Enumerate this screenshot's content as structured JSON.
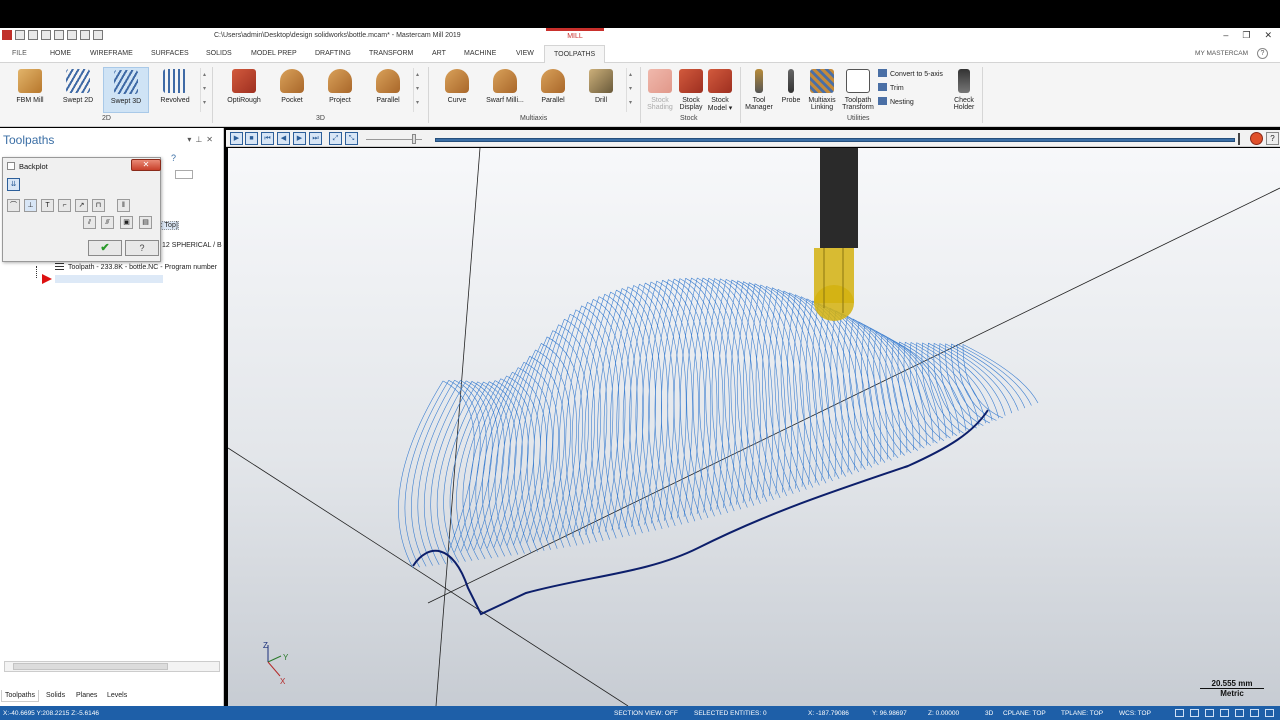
{
  "window": {
    "title": "C:\\Users\\admin\\Desktop\\design solidworks\\bottle.mcam* - Mastercam Mill 2019",
    "context_tab": "MILL",
    "controls": [
      "–",
      "❐",
      "✕"
    ]
  },
  "ribbon_tabs": [
    "FILE",
    "HOME",
    "WIREFRAME",
    "SURFACES",
    "SOLIDS",
    "MODEL PREP",
    "DRAFTING",
    "TRANSFORM",
    "ART",
    "MACHINE",
    "VIEW",
    "TOOLPATHS"
  ],
  "ribbon_active_tab": "TOOLPATHS",
  "my_mastercam": "MY MASTERCAM",
  "ribbon": {
    "group_2d": {
      "label": "2D",
      "buttons": [
        "FBM Mill",
        "Swept 2D",
        "Swept 3D",
        "Revolved"
      ]
    },
    "group_3d": {
      "label": "3D",
      "buttons": [
        "OptiRough",
        "Pocket",
        "Project",
        "Parallel"
      ]
    },
    "group_multiaxis": {
      "label": "Multiaxis",
      "buttons": [
        "Curve",
        "Swarf Milli...",
        "Parallel",
        "Drill"
      ]
    },
    "group_stock": {
      "label": "Stock",
      "buttons": [
        {
          "line1": "Stock",
          "line2": "Shading"
        },
        {
          "line1": "Stock",
          "line2": "Display"
        },
        {
          "line1": "Stock",
          "line2": "Model ▾"
        }
      ]
    },
    "group_utilities": {
      "label": "Utilities",
      "buttons": [
        {
          "line1": "Tool",
          "line2": "Manager"
        },
        {
          "line1": "Probe",
          "line2": ""
        },
        {
          "line1": "Multiaxis",
          "line2": "Linking"
        },
        {
          "line1": "Toolpath",
          "line2": "Transform"
        },
        {
          "line1": "Check",
          "line2": "Holder"
        }
      ],
      "small_options": [
        "Convert to 5-axis",
        "Trim",
        "Nesting"
      ]
    }
  },
  "toolpaths_panel": {
    "title": "Toolpaths",
    "tree": {
      "plane_fragment": "ne: Top]",
      "tool_fragment": "12 SPHERICAL / B",
      "toolpath": "Toolpath - 233.8K - bottle.NC - Program number"
    },
    "bottom_tabs": [
      "Toolpaths",
      "Solids",
      "Planes",
      "Levels"
    ]
  },
  "backplot_dialog": {
    "title": "Backplot",
    "close": "✕",
    "ok": "✔",
    "help": "?"
  },
  "viewport": {
    "scale_value": "20.555 mm",
    "scale_unit": "Metric",
    "axis_labels": [
      "Z",
      "Y",
      "X"
    ],
    "toolpath_color": "#3d7fd0",
    "tool_color": "#d4b20f"
  },
  "status_bar": {
    "coords_left": "X:-40.6695  Y:208.2215  Z:-5.6146",
    "section_view": "SECTION VIEW: OFF",
    "selected_entities": "SELECTED ENTITIES: 0",
    "x": "X:   -187.79086",
    "y": "Y:   96.98697",
    "z": "Z:   0.00000",
    "mode": "3D",
    "cplane": "CPLANE: TOP",
    "tplane": "TPLANE: TOP",
    "wcs": "WCS: TOP"
  }
}
